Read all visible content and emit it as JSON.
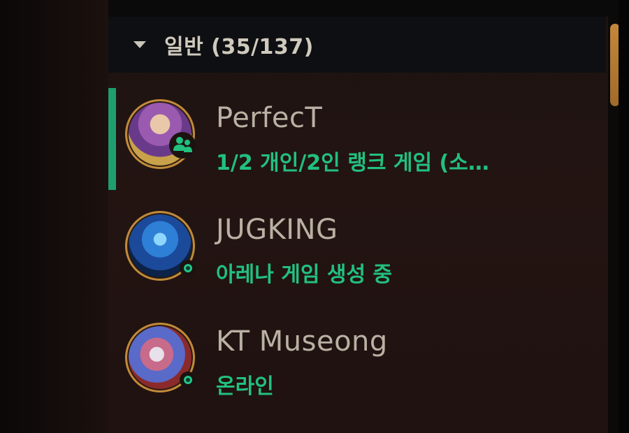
{
  "group": {
    "label": "일반 (35/137)"
  },
  "friends": [
    {
      "name": "PerfecT",
      "status": "1/2 개인/2인 랭크 게임 (소…",
      "selected": true,
      "presence_icon": "in-game-party-icon"
    },
    {
      "name": "JUGKING",
      "status": "아레나 게임 생성 중",
      "selected": false,
      "presence_icon": "online-dot-icon"
    },
    {
      "name": "KT Museong",
      "status": "온라인",
      "selected": false,
      "presence_icon": "online-dot-icon"
    }
  ],
  "colors": {
    "accent_green": "#22c07f",
    "selection_bar": "#1f9e6f",
    "avatar_border": "#c08a3a",
    "scroll_thumb": "#c4883a"
  }
}
